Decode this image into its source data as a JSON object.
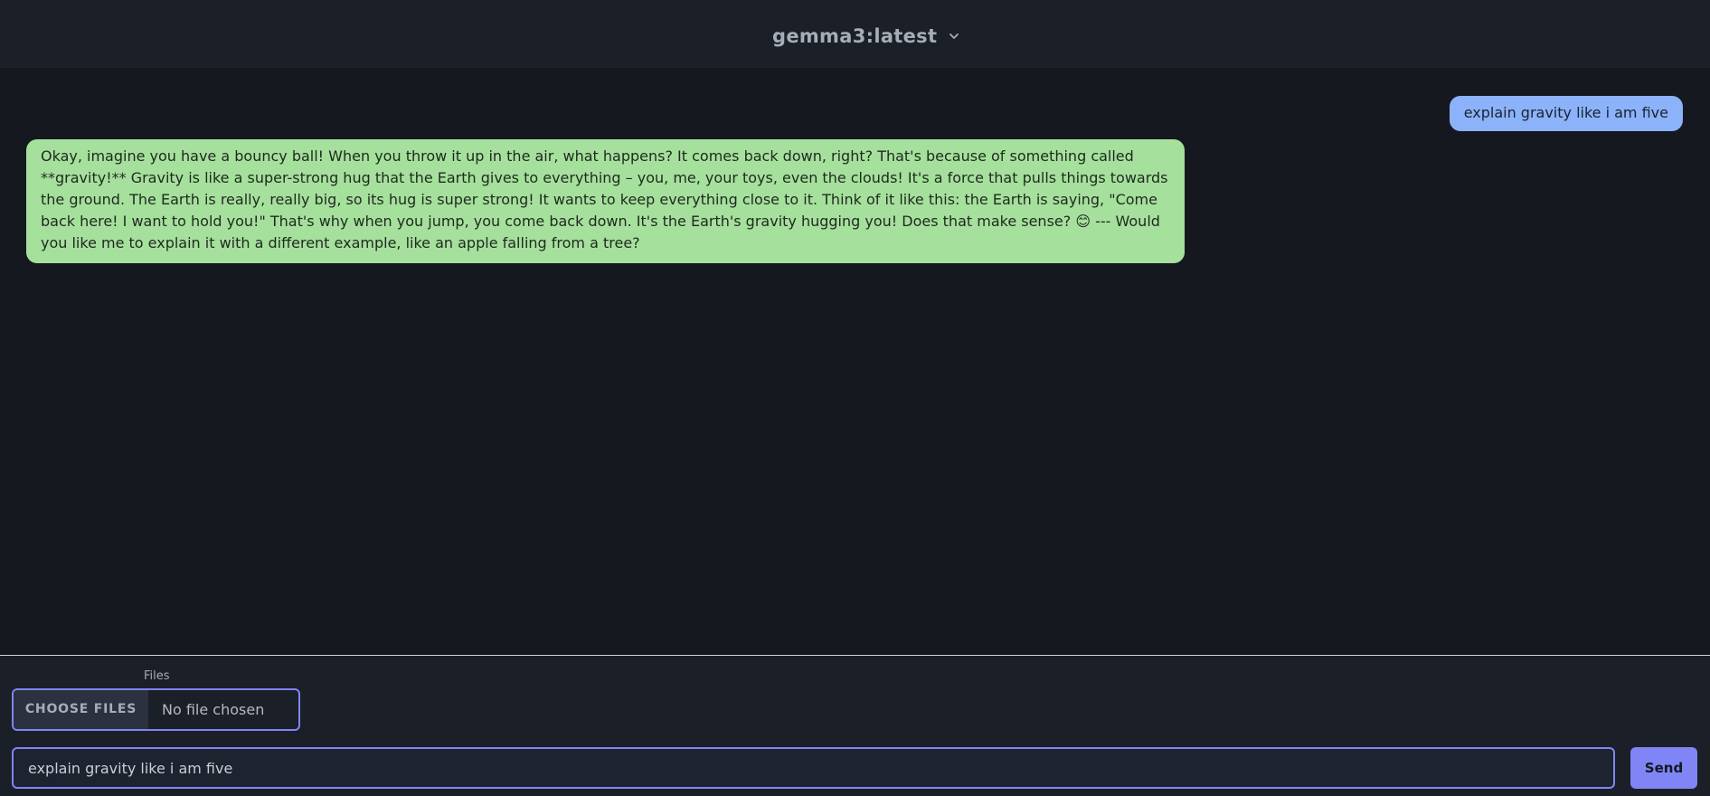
{
  "header": {
    "model_select": {
      "value": "gemma3:latest",
      "icon": "chevron-down-icon"
    }
  },
  "chat": {
    "messages": [
      {
        "role": "user",
        "text": "explain gravity like i am five"
      },
      {
        "role": "assistant",
        "text": "Okay, imagine you have a bouncy ball! When you throw it up in the air, what happens? It comes back down, right? That's because of something called **gravity!** Gravity is like a super-strong hug that the Earth gives to everything – you, me, your toys, even the clouds! It's a force that pulls things towards the ground. The Earth is really, really big, so its hug is super strong! It wants to keep everything close to it. Think of it like this: the Earth is saying, \"Come back here! I want to hold you!\" That's why when you jump, you come back down. It's the Earth's gravity hugging you! Does that make sense? 😊 --- Would you like me to explain it with a different example, like an apple falling from a tree?"
      }
    ]
  },
  "composer": {
    "files_label": "Files",
    "choose_files_label": "CHOOSE FILES",
    "no_file_text": "No file chosen",
    "message_value": "explain gravity like i am five",
    "send_label": "Send"
  },
  "colors": {
    "background": "#15181e",
    "header_bg": "#1b1f27",
    "user_bubble": "#8cb3f9",
    "assistant_bubble": "#a6e09d",
    "accent": "#7f85f5"
  }
}
